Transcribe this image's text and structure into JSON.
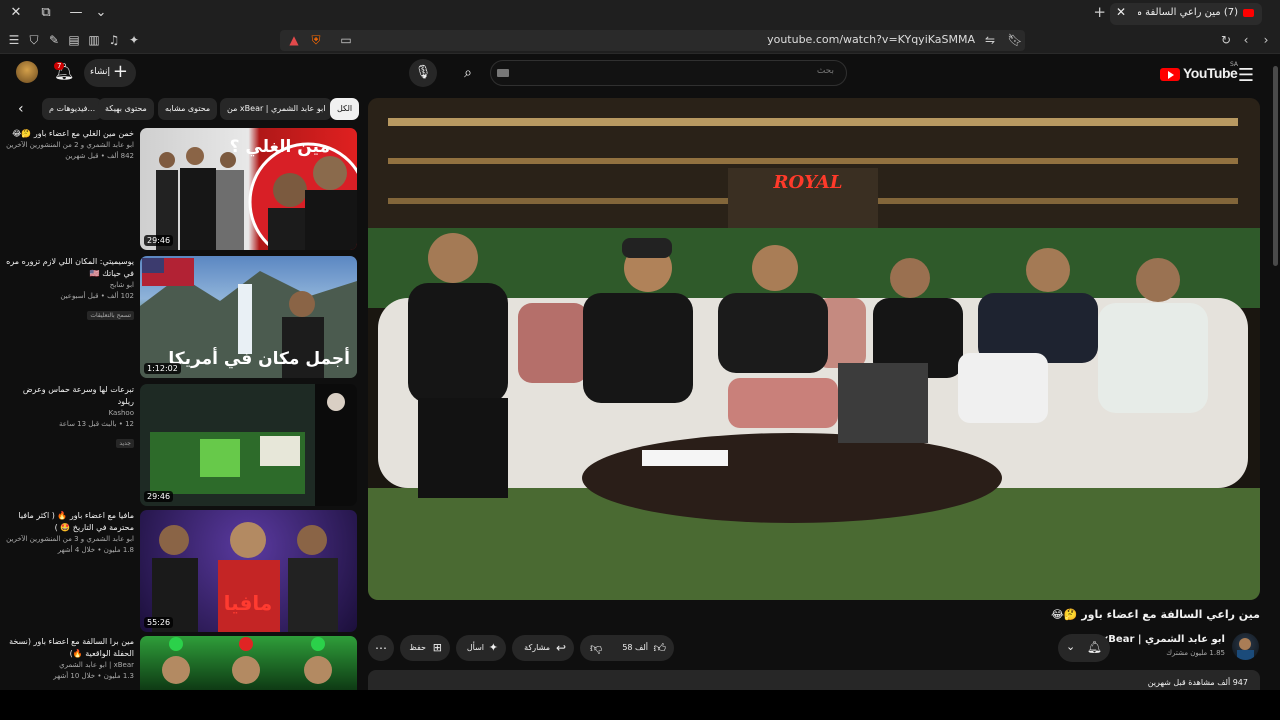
{
  "browser": {
    "tab_title": "(7) مين راعي السالفة مع اعضاء",
    "new_tab_icon": "+",
    "url": "youtube.com/watch?v=KYqyiKaSMMA"
  },
  "header": {
    "logo_text": "YouTube",
    "logo_region": "SA",
    "search_placeholder": "بحث",
    "create_label": "إنشاء",
    "notifications_count": "7"
  },
  "chips": [
    "الكل",
    "من xBear | ابو عابد الشمري",
    "محتوى مشابه",
    "محتوى بهيكة",
    "فيديوهات م..."
  ],
  "recommendations": [
    {
      "title": "خمن مين الغلي مع اعضاء باور 🤔😂",
      "channel": "ابو عابد الشمري و 2 من المنشورين الآخرين",
      "meta": "842 ألف • قبل شهرين",
      "duration": "29:46",
      "thumb_text": "مين الغلي ؟",
      "badge": ""
    },
    {
      "title": "يوسيميتي: المكان اللي لازم تزوره مره في حياتك 🇺🇸",
      "channel": "ابو شابح",
      "meta": "102 ألف • قبل أسبوعين",
      "duration": "1:12:02",
      "thumb_text": "أجمل مكان في أمريكا",
      "badge": "تسمح بالتعليقات"
    },
    {
      "title": "تبرعات لها وسرعة حماس وعرض ريلود",
      "channel": "Kashoo",
      "meta": "12 • بالبث قبل 13 ساعة",
      "duration": "29:46",
      "thumb_text": "",
      "badge": "جديد"
    },
    {
      "title": "مافيا مع اعضاء باور 🔥 ( اكثر مافيا محترمة في التاريخ 🤩 )",
      "channel": "ابو عابد الشمري و 3 من المنشورين الآخرين",
      "meta": "1.8 مليون • خلال 4 أشهر",
      "duration": "55:26",
      "thumb_text": "مافيا",
      "badge": ""
    },
    {
      "title": "مين برا السالفة مع اعضاء باور (نسخة الحفلة الواقعية 🔥)",
      "channel": "xBear | ابو عابد الشمري",
      "meta": "1.3 مليون • خلال 10 أشهر",
      "duration": "",
      "thumb_text": "",
      "badge": ""
    }
  ],
  "video": {
    "title": "مين راعي السالفة مع اعضاء باور 🤔😂",
    "channel": "ابو عابد الشمري | xBear",
    "subscribers": "1.85 مليون مشترك",
    "likes": "58 ألف",
    "share_label": "مشاركة",
    "ask_label": "اسأل",
    "save_label": "حفظ",
    "description": "947 ألف مشاهدة قبل شهرين",
    "sign_text": "ROYAL"
  },
  "colors": {
    "background": "#0f0f0f",
    "chip": "#272727",
    "brand_red": "#ff0000"
  }
}
